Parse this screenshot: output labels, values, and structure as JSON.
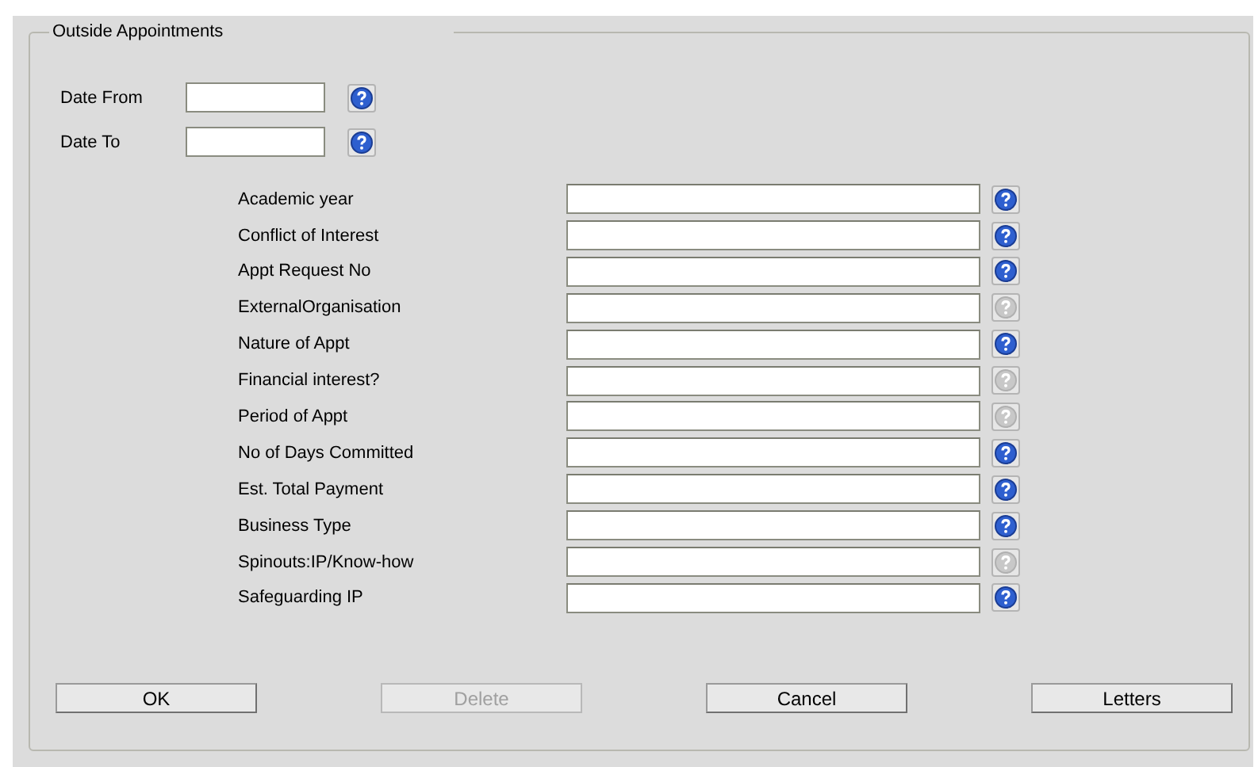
{
  "group": {
    "title": "Outside Appointments"
  },
  "date_fields": [
    {
      "label": "Date From",
      "help_enabled": true
    },
    {
      "label": "Date To",
      "help_enabled": true
    }
  ],
  "fields": [
    {
      "label": "Academic year",
      "help_enabled": true
    },
    {
      "label": "Conflict of Interest",
      "help_enabled": true
    },
    {
      "label": "Appt Request No",
      "help_enabled": true
    },
    {
      "label": "ExternalOrganisation",
      "help_enabled": false
    },
    {
      "label": "Nature of Appt",
      "help_enabled": true
    },
    {
      "label": "Financial interest?",
      "help_enabled": false
    },
    {
      "label": "Period of Appt",
      "help_enabled": false
    },
    {
      "label": "No of Days Committed",
      "help_enabled": true
    },
    {
      "label": "Est. Total Payment",
      "help_enabled": true
    },
    {
      "label": "Business Type",
      "help_enabled": true
    },
    {
      "label": "Spinouts:IP/Know-how",
      "help_enabled": false
    },
    {
      "label": "Safeguarding IP",
      "help_enabled": true
    }
  ],
  "buttons": [
    {
      "label": "OK",
      "disabled": false
    },
    {
      "label": "Delete",
      "disabled": true
    },
    {
      "label": "Cancel",
      "disabled": false
    },
    {
      "label": "Letters",
      "disabled": false
    }
  ]
}
